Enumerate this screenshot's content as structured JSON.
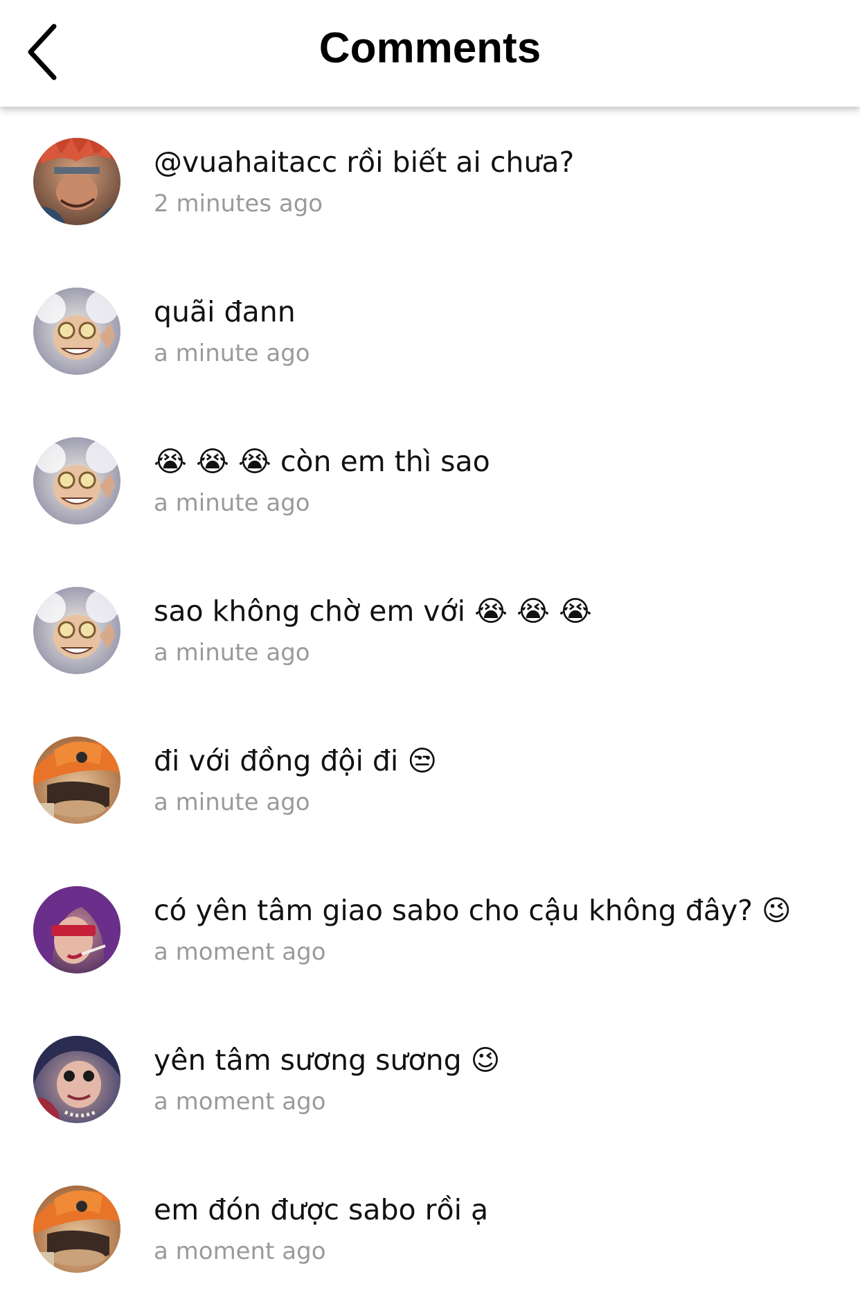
{
  "header": {
    "title": "Comments"
  },
  "icons": {
    "back": "chevron-left-icon"
  },
  "comments": [
    {
      "avatar": "red-haired-character-avatar",
      "text": "@vuahaitacc rồi biết ai chưa?",
      "time": "2 minutes ago"
    },
    {
      "avatar": "white-haired-grinning-character-avatar",
      "text": "quãi đann",
      "time": "a minute ago"
    },
    {
      "avatar": "white-haired-grinning-character-avatar",
      "text": "😭 😭 😭 còn em thì sao",
      "time": "a minute ago"
    },
    {
      "avatar": "white-haired-grinning-character-avatar",
      "text": "sao không chờ em với 😭 😭 😭",
      "time": "a minute ago"
    },
    {
      "avatar": "orange-hat-character-avatar",
      "text": "đi với đồng đội đi 😒",
      "time": "a minute ago"
    },
    {
      "avatar": "purple-haired-sunglasses-character-avatar",
      "text": "có yên tâm giao sabo cho cậu không đây? 😉",
      "time": "a moment ago"
    },
    {
      "avatar": "dark-haired-star-eyes-character-avatar",
      "text": "yên tâm sương sương 😉",
      "time": "a moment ago"
    },
    {
      "avatar": "orange-hat-character-avatar",
      "text": "em đón được sabo rồi ạ",
      "time": "a moment ago"
    }
  ]
}
